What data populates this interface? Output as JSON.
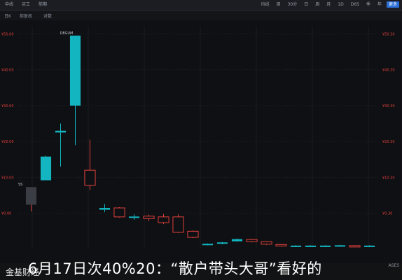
{
  "toolbar": {
    "left_items": [
      "中线",
      "买工",
      "前期"
    ],
    "right_items": [
      "均线",
      "周",
      "30分",
      "日",
      "周",
      "月",
      "1D",
      "D6S",
      "季",
      "年",
      "更多"
    ],
    "active_index": 10
  },
  "subbar": {
    "item1": "日K",
    "item2": "前复权",
    "item3": "对数"
  },
  "chart_data": {
    "type": "candlestick",
    "y_axis_labels": [
      "¥50.00",
      "¥40.00",
      "¥30.00",
      "¥20.00",
      "¥10.00",
      "¥0.00"
    ],
    "y_axis_right_labels": [
      "¥50.30",
      "¥40.30",
      "¥30.30",
      "¥20.30",
      "¥10.30",
      "¥0.30"
    ],
    "peak_label": "DEGUM",
    "left_marker": "SS",
    "up_color": "#12b5c0",
    "down_color": "#e0403c",
    "candles": [
      {
        "open": 7.3,
        "close": 2.4,
        "high": 7.3,
        "low": 0.5,
        "dir": "flat"
      },
      {
        "open": 9.2,
        "close": 15.8,
        "high": 16.0,
        "low": 9.2,
        "dir": "up"
      },
      {
        "open": 22.5,
        "close": 23.0,
        "high": 25.0,
        "low": 13.0,
        "dir": "up"
      },
      {
        "open": 30.0,
        "close": 49.5,
        "high": 49.5,
        "low": 19.0,
        "dir": "up"
      },
      {
        "open": 12.0,
        "close": 7.8,
        "high": 20.5,
        "low": 6.5,
        "dir": "down"
      },
      {
        "open": 1.5,
        "close": 1.0,
        "high": 2.6,
        "low": 0.3,
        "dir": "up"
      },
      {
        "open": 1.5,
        "close": -1.0,
        "high": 1.7,
        "low": -1.2,
        "dir": "down"
      },
      {
        "open": -1.2,
        "close": -0.9,
        "high": -0.3,
        "low": -1.8,
        "dir": "up"
      },
      {
        "open": -0.8,
        "close": -1.5,
        "high": -0.4,
        "low": -2.2,
        "dir": "down"
      },
      {
        "open": -1.0,
        "close": -2.6,
        "high": -0.2,
        "low": -3.0,
        "dir": "down"
      },
      {
        "open": -1.0,
        "close": -5.3,
        "high": -0.3,
        "low": -5.5,
        "dir": "down"
      },
      {
        "open": -5.0,
        "close": -6.7,
        "high": -4.8,
        "low": -6.9,
        "dir": "down"
      },
      {
        "open": -8.7,
        "close": -8.5,
        "high": -8.4,
        "low": -8.9,
        "dir": "up"
      },
      {
        "open": -8.4,
        "close": -8.1,
        "high": -8.0,
        "low": -8.6,
        "dir": "up"
      },
      {
        "open": -7.8,
        "close": -7.2,
        "high": -7.0,
        "low": -7.9,
        "dir": "up"
      },
      {
        "open": -7.3,
        "close": -7.9,
        "high": -7.1,
        "low": -8.1,
        "dir": "down"
      },
      {
        "open": -7.9,
        "close": -8.6,
        "high": -7.8,
        "low": -8.8,
        "dir": "down"
      },
      {
        "open": -8.7,
        "close": -9.1,
        "high": -8.6,
        "low": -9.3,
        "dir": "down"
      },
      {
        "open": -9.3,
        "close": -9.0,
        "high": -8.9,
        "low": -9.4,
        "dir": "up"
      },
      {
        "open": -9.2,
        "close": -9.0,
        "high": -8.9,
        "low": -9.3,
        "dir": "up"
      },
      {
        "open": -9.2,
        "close": -9.0,
        "high": -8.9,
        "low": -9.3,
        "dir": "up"
      },
      {
        "open": -9.2,
        "close": -8.9,
        "high": -8.8,
        "low": -9.3,
        "dir": "up"
      },
      {
        "open": -9.0,
        "close": -9.2,
        "high": -8.9,
        "low": -9.3,
        "dir": "down"
      },
      {
        "open": -9.2,
        "close": -9.0,
        "high": -8.9,
        "low": -9.3,
        "dir": "up"
      }
    ]
  },
  "caption": {
    "headline": "6月17日次40%20：“散户带头大哥”看好的",
    "source": "金基财经",
    "right_tag": "ASES"
  }
}
